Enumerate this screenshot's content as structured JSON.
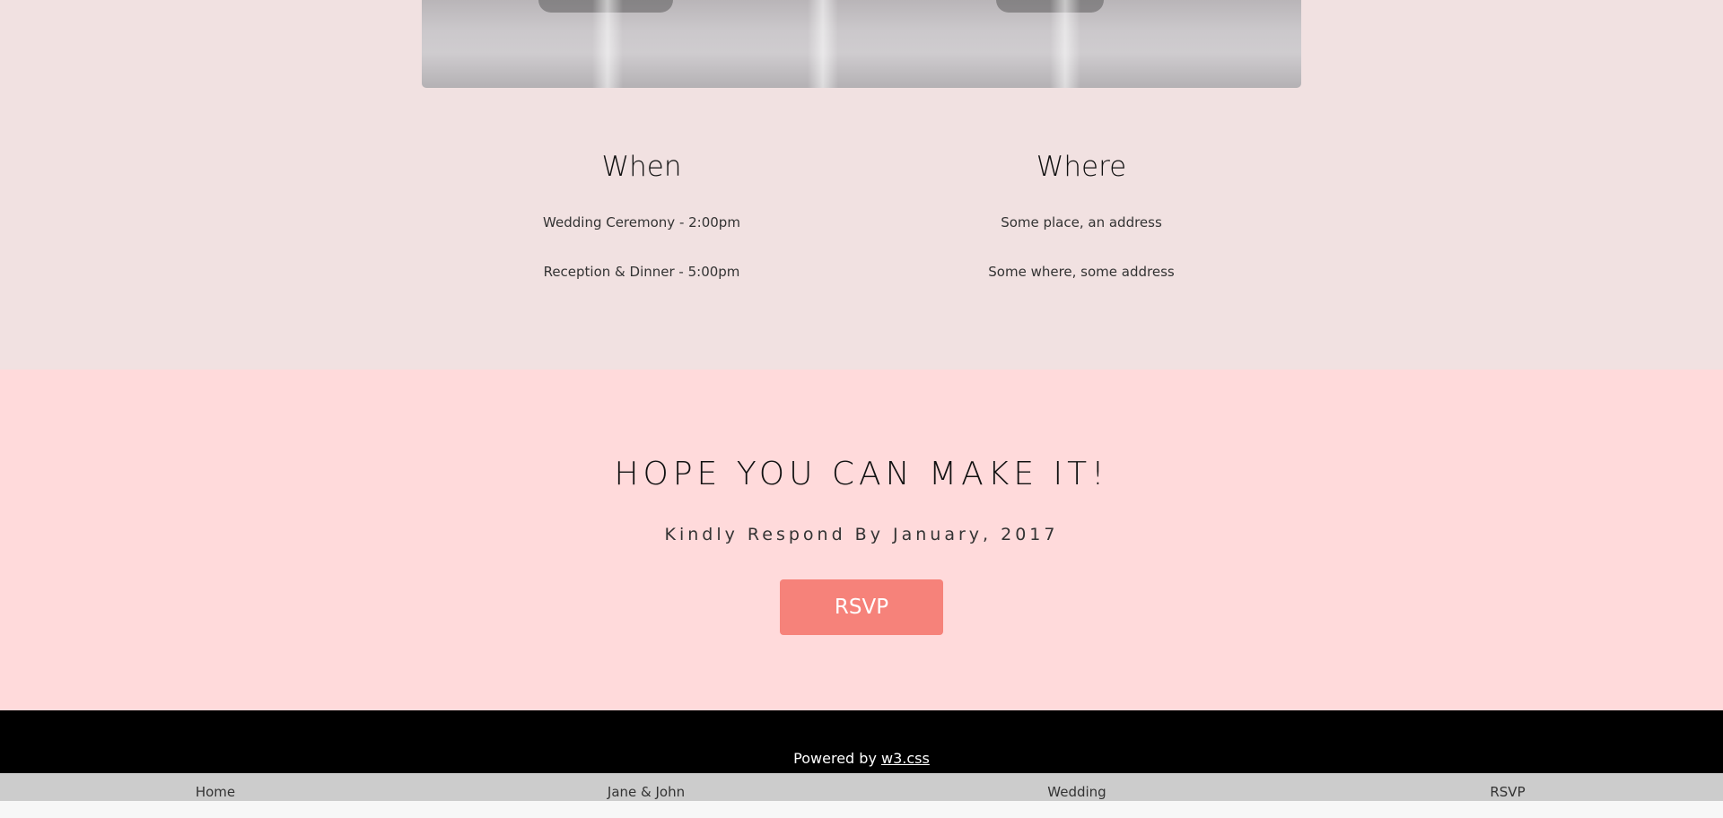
{
  "details": {
    "when": {
      "heading": "When",
      "lines": [
        "Wedding Ceremony - 2:00pm",
        "Reception & Dinner - 5:00pm"
      ]
    },
    "where": {
      "heading": "Where",
      "lines": [
        "Some place, an address",
        "Some where, some address"
      ]
    }
  },
  "rsvp": {
    "heading": "HOPE YOU CAN MAKE IT!",
    "respond_by": "Kindly Respond By January, 2017",
    "button_label": "RSVP"
  },
  "footer": {
    "powered_prefix": "Powered by",
    "link_label": "w3.css"
  },
  "nav": {
    "items": [
      {
        "label": "Home"
      },
      {
        "label": "Jane & John"
      },
      {
        "label": "Wedding"
      },
      {
        "label": "RSVP"
      }
    ]
  },
  "colors": {
    "top_background": "#f1e1e1",
    "rsvp_background": "#ffdadb",
    "rsvp_button": "#f6827a",
    "footer_background": "#000000",
    "nav_background": "#cccccc"
  }
}
